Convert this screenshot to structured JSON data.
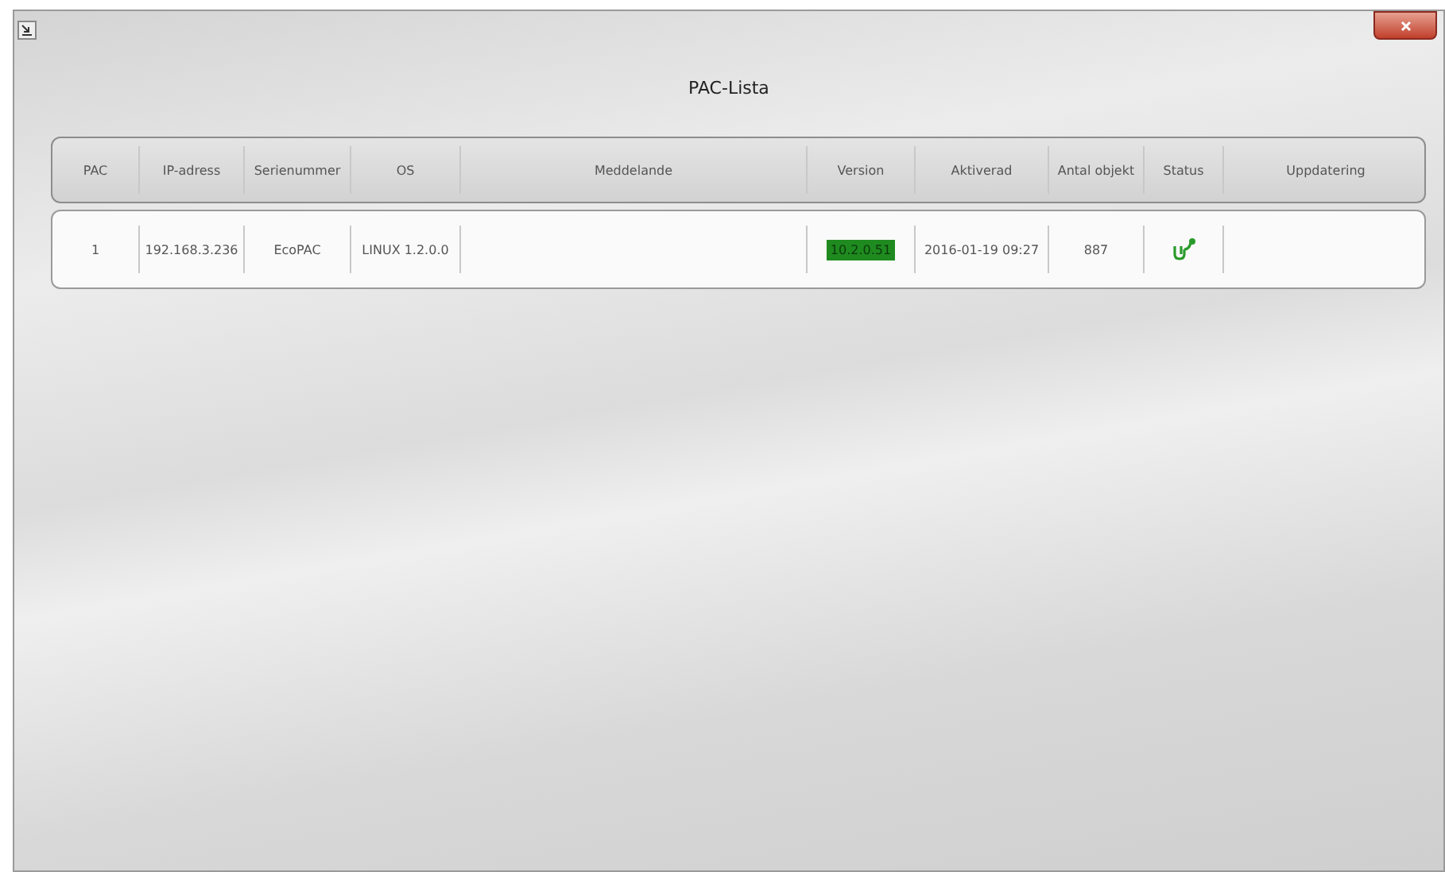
{
  "window": {
    "title": "PAC-Lista"
  },
  "table": {
    "columns": [
      "PAC",
      "IP-adress",
      "Serienummer",
      "OS",
      "Meddelande",
      "Version",
      "Aktiverad",
      "Antal objekt",
      "Status",
      "Uppdatering"
    ],
    "rows": [
      {
        "pac": "1",
        "ip": "192.168.3.236",
        "serial": "EcoPAC",
        "os": "LINUX 1.2.0.0",
        "version": "10.2.0.51",
        "version_ok": true,
        "activated": "2016-01-19 09:27",
        "objects": "887",
        "connected": true
      }
    ]
  }
}
